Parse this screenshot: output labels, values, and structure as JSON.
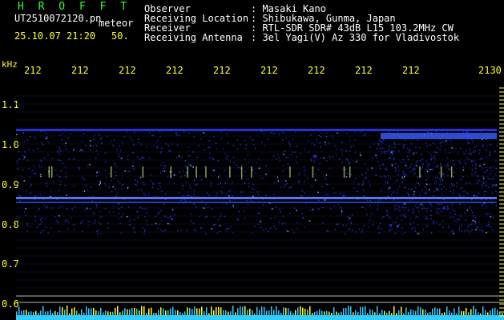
{
  "header": {
    "title": "H R O F F T",
    "filename": "UT2510072120.pn",
    "meteor_label": "meteor",
    "date_time": "25.10.07 21:20",
    "count": "50."
  },
  "info": [
    {
      "label": "Observer",
      "value": ": Masaki Kano"
    },
    {
      "label": "Receiving Location",
      "value": ": Shibukawa, Gunma, Japan"
    },
    {
      "label": "Receiver",
      "value": ": RTL-SDR SDR# 43dB L15 103.2MHz CW"
    },
    {
      "label": "Receiving Antenna",
      "value": ": 3el Yagi(V) Az 330 for Vladivostok"
    }
  ],
  "axes": {
    "unit": "kHz",
    "x_ticks": [
      "212",
      "212",
      "212",
      "212",
      "212",
      "212",
      "212",
      "212",
      "212",
      "2130"
    ],
    "y_ticks": [
      "1.1",
      "1.0",
      "0.9",
      "0.8",
      "0.7",
      "0.6"
    ]
  },
  "colors": {
    "background": "#000000",
    "text_white": "#ffffff",
    "text_yellow": "#ffff33",
    "text_green": "#33ff33",
    "signal": "#3355ff",
    "bottom_band": "#33ccff"
  }
}
